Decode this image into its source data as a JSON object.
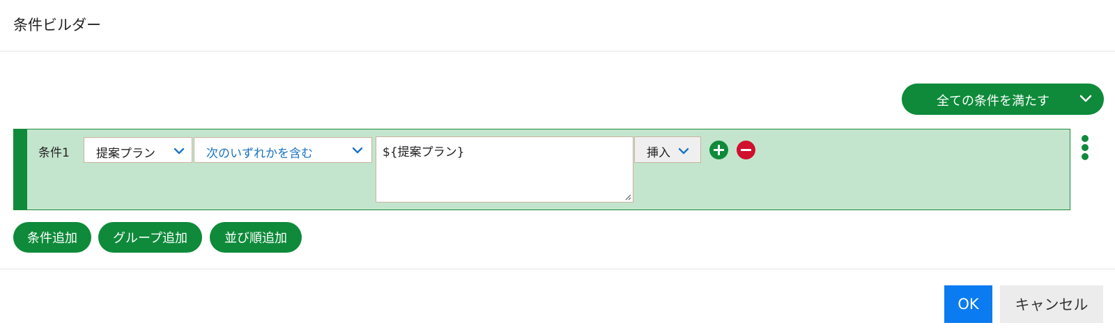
{
  "dialog": {
    "title": "条件ビルダー"
  },
  "match_mode": {
    "label": "全ての条件を満たす"
  },
  "condition": {
    "label": "条件1",
    "field": "提案プラン",
    "operator": "次のいずれかを含む",
    "value": "${提案プラン}",
    "insert_label": "挿入"
  },
  "actions": {
    "add_condition": "条件追加",
    "add_group": "グループ追加",
    "add_sort": "並び順追加"
  },
  "footer": {
    "ok": "OK",
    "cancel": "キャンセル"
  },
  "colors": {
    "accent": "#0e8a3a",
    "row_bg": "#c4e5cd",
    "danger": "#d0102d",
    "primary": "#0a7bf0",
    "link": "#1a73c4"
  },
  "icons": {
    "chevron": "chevron-down-icon",
    "add": "plus-circle-icon",
    "remove": "minus-circle-icon",
    "more": "kebab-menu-icon"
  }
}
